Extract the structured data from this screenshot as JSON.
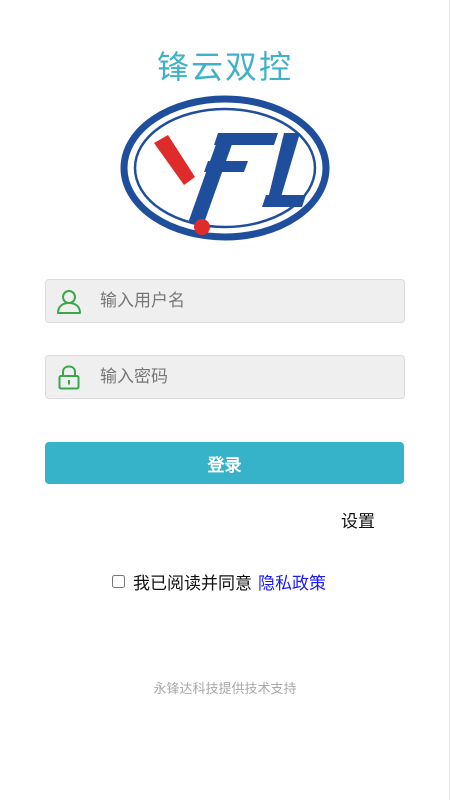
{
  "app": {
    "title": "锋云双控"
  },
  "login_form": {
    "username_placeholder": "输入用户名",
    "password_placeholder": "输入密码",
    "login_label": "登录",
    "settings_label": "设置"
  },
  "agreement": {
    "checked": false,
    "text": "我已阅读并同意",
    "privacy_link": "隐私政策"
  },
  "footer": {
    "support_text": "永锋达科技提供技术支持"
  },
  "icons": {
    "user": "user-icon",
    "lock": "lock-icon"
  },
  "colors": {
    "accent": "#36b3c9",
    "title": "#3fb2c8",
    "icon_green": "#3aa84a",
    "logo_blue": "#1f4f9c",
    "logo_red": "#e02b2b",
    "link": "#1a1aff"
  }
}
